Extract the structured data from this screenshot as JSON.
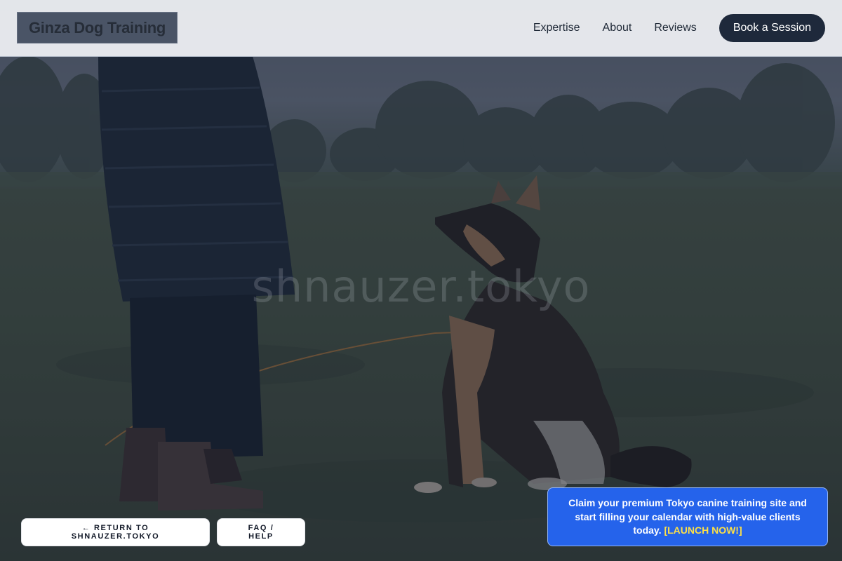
{
  "header": {
    "logo": "Ginza Dog Training",
    "nav": [
      {
        "label": "Expertise"
      },
      {
        "label": "About"
      },
      {
        "label": "Reviews"
      }
    ],
    "cta_label": "Book a Session"
  },
  "hero": {
    "watermark": "shnauzer.tokyo"
  },
  "footer_buttons": {
    "return_label": "← RETURN TO SHNAUZER.TOKYO",
    "faq_label": "FAQ / HELP"
  },
  "promo": {
    "text": "Claim your premium Tokyo canine training site and start filling your calendar with high-value clients today. ",
    "link_label": "[LAUNCH NOW!]"
  },
  "colors": {
    "header_bg": "#f0f2f5",
    "cta_bg": "#1e293b",
    "promo_bg": "#2563eb",
    "promo_link": "#fde047"
  }
}
